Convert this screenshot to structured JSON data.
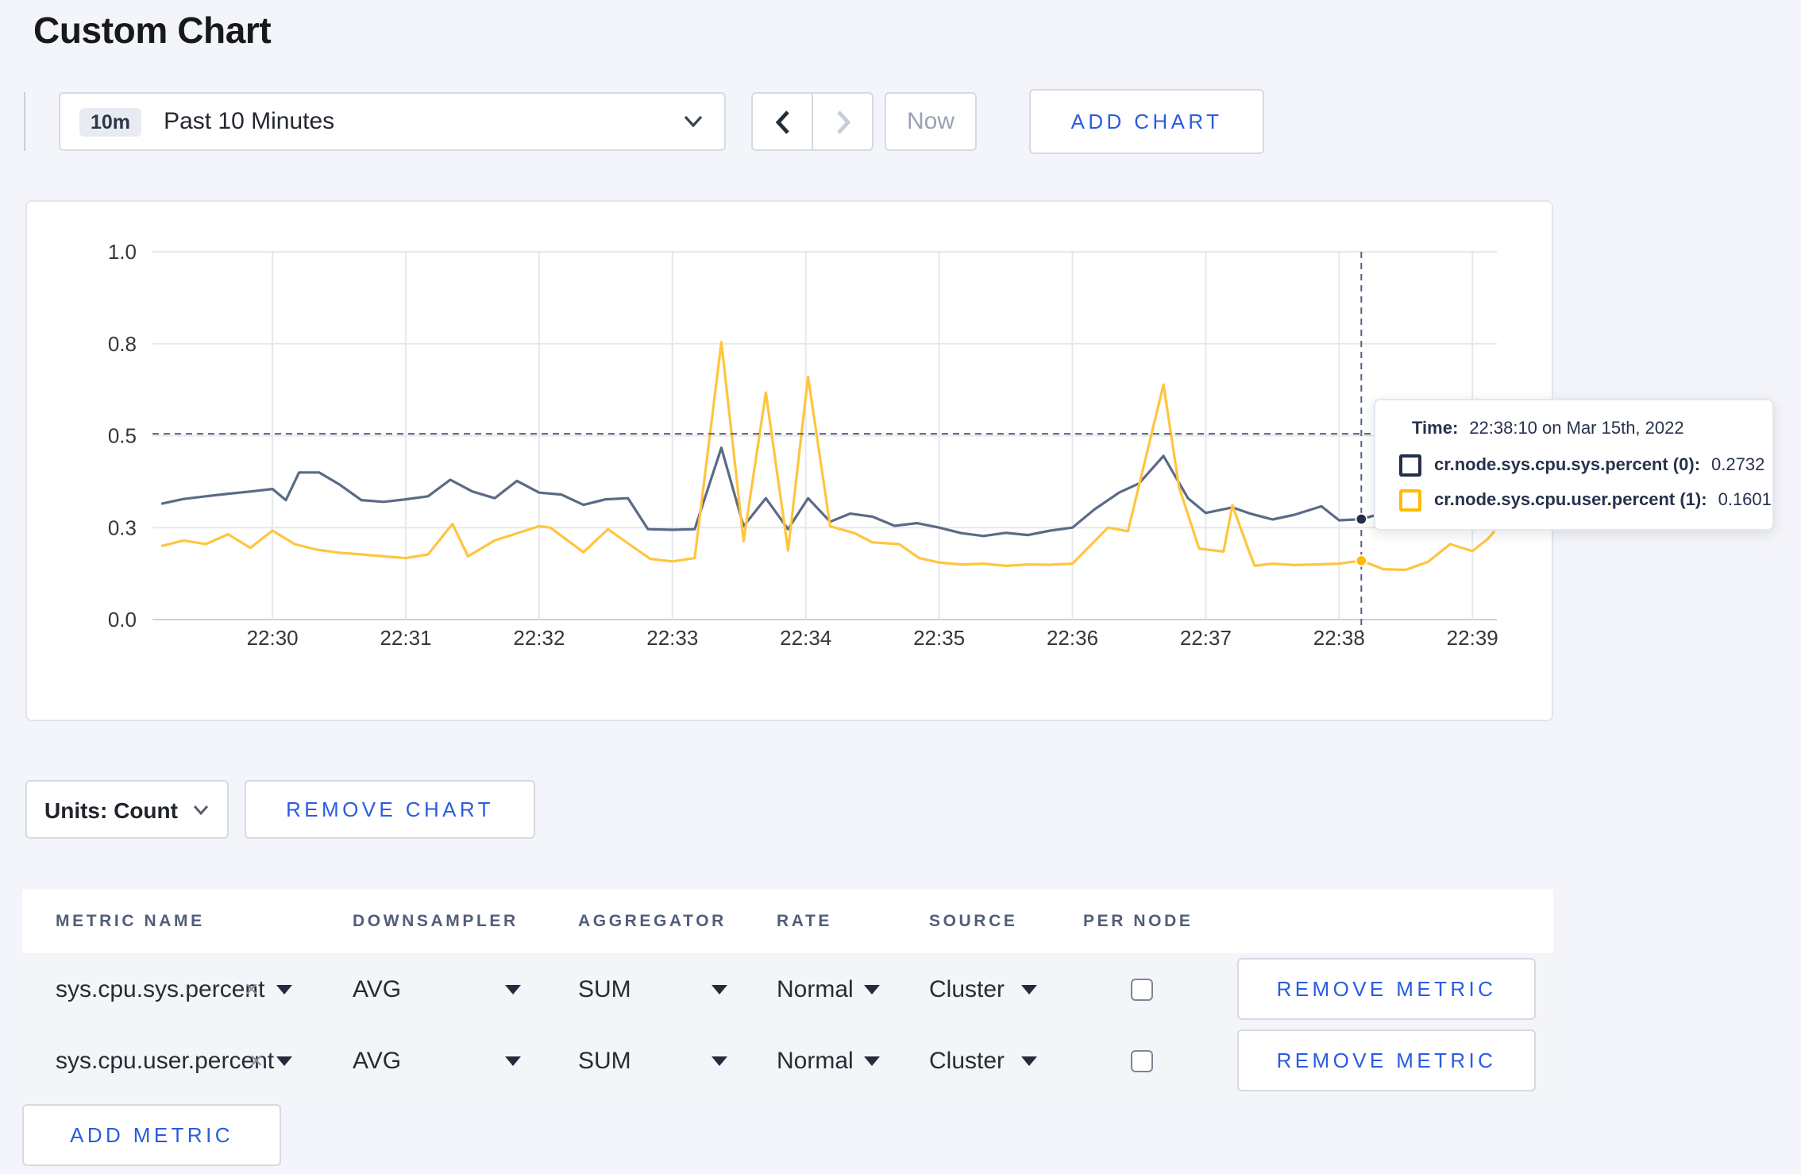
{
  "page": {
    "title": "Custom Chart",
    "background_color": "#F4F5FA",
    "accent_blue": "#2A5CE0"
  },
  "toolbar": {
    "time_window_badge": "10m",
    "time_window_label": "Past 10 Minutes",
    "now_label": "Now",
    "add_chart_label": "ADD CHART"
  },
  "chart_data": {
    "type": "line",
    "title": "",
    "xlabel": "",
    "ylabel": "",
    "grid": true,
    "legend_position": "tooltip",
    "x_axis": {
      "start": "22:29:06",
      "end": "22:39:11",
      "ticks": [
        {
          "time": "22:30:00",
          "label": "22:30"
        },
        {
          "time": "22:31:00",
          "label": "22:31"
        },
        {
          "time": "22:32:00",
          "label": "22:32"
        },
        {
          "time": "22:33:00",
          "label": "22:33"
        },
        {
          "time": "22:34:00",
          "label": "22:34"
        },
        {
          "time": "22:35:00",
          "label": "22:35"
        },
        {
          "time": "22:36:00",
          "label": "22:36"
        },
        {
          "time": "22:37:00",
          "label": "22:37"
        },
        {
          "time": "22:38:00",
          "label": "22:38"
        },
        {
          "time": "22:39:00",
          "label": "22:39"
        }
      ]
    },
    "y_axis": {
      "min": 0,
      "max": 1,
      "ticks": [
        {
          "value": 0,
          "label": "0.0"
        },
        {
          "value": 0.25,
          "label": "0.3"
        },
        {
          "value": 0.5,
          "label": "0.5"
        },
        {
          "value": 0.75,
          "label": "0.8"
        },
        {
          "value": 1,
          "label": "1.0"
        }
      ]
    },
    "series": [
      {
        "name": "cr.node.sys.cpu.sys.percent",
        "line_color": "#5B6A86",
        "legend_color": "#232F4B",
        "points": [
          [
            "22:29:10",
            0.315
          ],
          [
            "22:29:20",
            0.328
          ],
          [
            "22:29:30",
            0.335
          ],
          [
            "22:29:40",
            0.342
          ],
          [
            "22:29:50",
            0.348
          ],
          [
            "22:30:00",
            0.355
          ],
          [
            "22:30:06",
            0.325
          ],
          [
            "22:30:12",
            0.4
          ],
          [
            "22:30:21",
            0.4
          ],
          [
            "22:30:30",
            0.368
          ],
          [
            "22:30:40",
            0.325
          ],
          [
            "22:30:50",
            0.32
          ],
          [
            "22:31:00",
            0.327
          ],
          [
            "22:31:10",
            0.335
          ],
          [
            "22:31:20",
            0.38
          ],
          [
            "22:31:30",
            0.348
          ],
          [
            "22:31:40",
            0.33
          ],
          [
            "22:31:50",
            0.377
          ],
          [
            "22:32:00",
            0.345
          ],
          [
            "22:32:10",
            0.34
          ],
          [
            "22:32:20",
            0.312
          ],
          [
            "22:32:30",
            0.327
          ],
          [
            "22:32:40",
            0.33
          ],
          [
            "22:32:49",
            0.246
          ],
          [
            "22:33:00",
            0.244
          ],
          [
            "22:33:10",
            0.246
          ],
          [
            "22:33:22",
            0.467
          ],
          [
            "22:33:32",
            0.254
          ],
          [
            "22:33:42",
            0.33
          ],
          [
            "22:33:52",
            0.246
          ],
          [
            "22:34:01",
            0.33
          ],
          [
            "22:34:11",
            0.266
          ],
          [
            "22:34:20",
            0.288
          ],
          [
            "22:34:30",
            0.28
          ],
          [
            "22:34:40",
            0.255
          ],
          [
            "22:34:50",
            0.262
          ],
          [
            "22:35:00",
            0.25
          ],
          [
            "22:35:10",
            0.235
          ],
          [
            "22:35:20",
            0.227
          ],
          [
            "22:35:30",
            0.236
          ],
          [
            "22:35:40",
            0.23
          ],
          [
            "22:35:50",
            0.242
          ],
          [
            "22:36:00",
            0.25
          ],
          [
            "22:36:10",
            0.3
          ],
          [
            "22:36:21",
            0.345
          ],
          [
            "22:36:30",
            0.37
          ],
          [
            "22:36:41",
            0.445
          ],
          [
            "22:36:52",
            0.33
          ],
          [
            "22:37:00",
            0.29
          ],
          [
            "22:37:12",
            0.305
          ],
          [
            "22:37:20",
            0.288
          ],
          [
            "22:37:30",
            0.272
          ],
          [
            "22:37:40",
            0.285
          ],
          [
            "22:37:52",
            0.308
          ],
          [
            "22:38:00",
            0.27
          ],
          [
            "22:38:10",
            0.2732
          ],
          [
            "22:38:20",
            0.29
          ],
          [
            "22:38:30",
            0.3
          ],
          [
            "22:38:40",
            0.295
          ],
          [
            "22:38:50",
            0.3
          ],
          [
            "22:39:00",
            0.295
          ],
          [
            "22:39:10",
            0.3
          ]
        ]
      },
      {
        "name": "cr.node.sys.cpu.user.percent",
        "line_color": "#FFC53F",
        "legend_color": "#FFBB00",
        "points": [
          [
            "22:29:10",
            0.2
          ],
          [
            "22:29:20",
            0.215
          ],
          [
            "22:29:30",
            0.205
          ],
          [
            "22:29:40",
            0.232
          ],
          [
            "22:29:50",
            0.195
          ],
          [
            "22:30:00",
            0.242
          ],
          [
            "22:30:10",
            0.205
          ],
          [
            "22:30:20",
            0.19
          ],
          [
            "22:30:30",
            0.182
          ],
          [
            "22:30:40",
            0.177
          ],
          [
            "22:30:50",
            0.172
          ],
          [
            "22:31:00",
            0.167
          ],
          [
            "22:31:10",
            0.177
          ],
          [
            "22:31:21",
            0.26
          ],
          [
            "22:31:28",
            0.172
          ],
          [
            "22:31:40",
            0.215
          ],
          [
            "22:32:00",
            0.254
          ],
          [
            "22:32:05",
            0.25
          ],
          [
            "22:32:20",
            0.183
          ],
          [
            "22:32:31",
            0.246
          ],
          [
            "22:32:41",
            0.203
          ],
          [
            "22:32:50",
            0.165
          ],
          [
            "22:33:00",
            0.158
          ],
          [
            "22:33:10",
            0.167
          ],
          [
            "22:33:22",
            0.754
          ],
          [
            "22:33:32",
            0.214
          ],
          [
            "22:33:42",
            0.617
          ],
          [
            "22:33:52",
            0.188
          ],
          [
            "22:34:01",
            0.66
          ],
          [
            "22:34:11",
            0.254
          ],
          [
            "22:34:22",
            0.235
          ],
          [
            "22:34:30",
            0.21
          ],
          [
            "22:34:42",
            0.205
          ],
          [
            "22:34:51",
            0.167
          ],
          [
            "22:35:00",
            0.155
          ],
          [
            "22:35:10",
            0.15
          ],
          [
            "22:35:20",
            0.152
          ],
          [
            "22:35:30",
            0.146
          ],
          [
            "22:35:40",
            0.15
          ],
          [
            "22:35:50",
            0.149
          ],
          [
            "22:36:00",
            0.152
          ],
          [
            "22:36:16",
            0.25
          ],
          [
            "22:36:25",
            0.24
          ],
          [
            "22:36:41",
            0.639
          ],
          [
            "22:36:48",
            0.36
          ],
          [
            "22:36:57",
            0.193
          ],
          [
            "22:37:08",
            0.185
          ],
          [
            "22:37:12",
            0.311
          ],
          [
            "22:37:19",
            0.193
          ],
          [
            "22:37:22",
            0.146
          ],
          [
            "22:37:30",
            0.152
          ],
          [
            "22:37:40",
            0.148
          ],
          [
            "22:37:50",
            0.15
          ],
          [
            "22:38:00",
            0.152
          ],
          [
            "22:38:10",
            0.1601
          ],
          [
            "22:38:20",
            0.137
          ],
          [
            "22:38:30",
            0.135
          ],
          [
            "22:38:40",
            0.157
          ],
          [
            "22:38:50",
            0.205
          ],
          [
            "22:39:00",
            0.186
          ],
          [
            "22:39:07",
            0.22
          ],
          [
            "22:39:10",
            0.24
          ]
        ]
      }
    ],
    "crosshair": {
      "time": "22:38:10",
      "y_value": 0.505,
      "points": [
        {
          "series": 0,
          "value": 0.2732
        },
        {
          "series": 1,
          "value": 0.1601
        }
      ]
    }
  },
  "tooltip": {
    "time_label": "Time:",
    "time_value": "22:38:10 on Mar 15th, 2022",
    "series": [
      {
        "label": "cr.node.sys.cpu.sys.percent (0):",
        "value": "0.2732",
        "color": "#232F4B"
      },
      {
        "label": "cr.node.sys.cpu.user.percent (1):",
        "value": "0.1601",
        "color": "#FFBB00"
      }
    ]
  },
  "chart_footer": {
    "units_label": "Units: Count",
    "remove_chart_label": "REMOVE CHART"
  },
  "metrics_table": {
    "headers": [
      "METRIC NAME",
      "DOWNSAMPLER",
      "AGGREGATOR",
      "RATE",
      "SOURCE",
      "PER NODE"
    ],
    "rows": [
      {
        "metric_name": "sys.cpu.sys.percent",
        "downsampler": "AVG",
        "aggregator": "SUM",
        "rate": "Normal",
        "source": "Cluster",
        "per_node_checked": false
      },
      {
        "metric_name": "sys.cpu.user.percent",
        "downsampler": "AVG",
        "aggregator": "SUM",
        "rate": "Normal",
        "source": "Cluster",
        "per_node_checked": false
      }
    ],
    "remove_metric_label": "REMOVE METRIC",
    "add_metric_label": "ADD METRIC"
  }
}
